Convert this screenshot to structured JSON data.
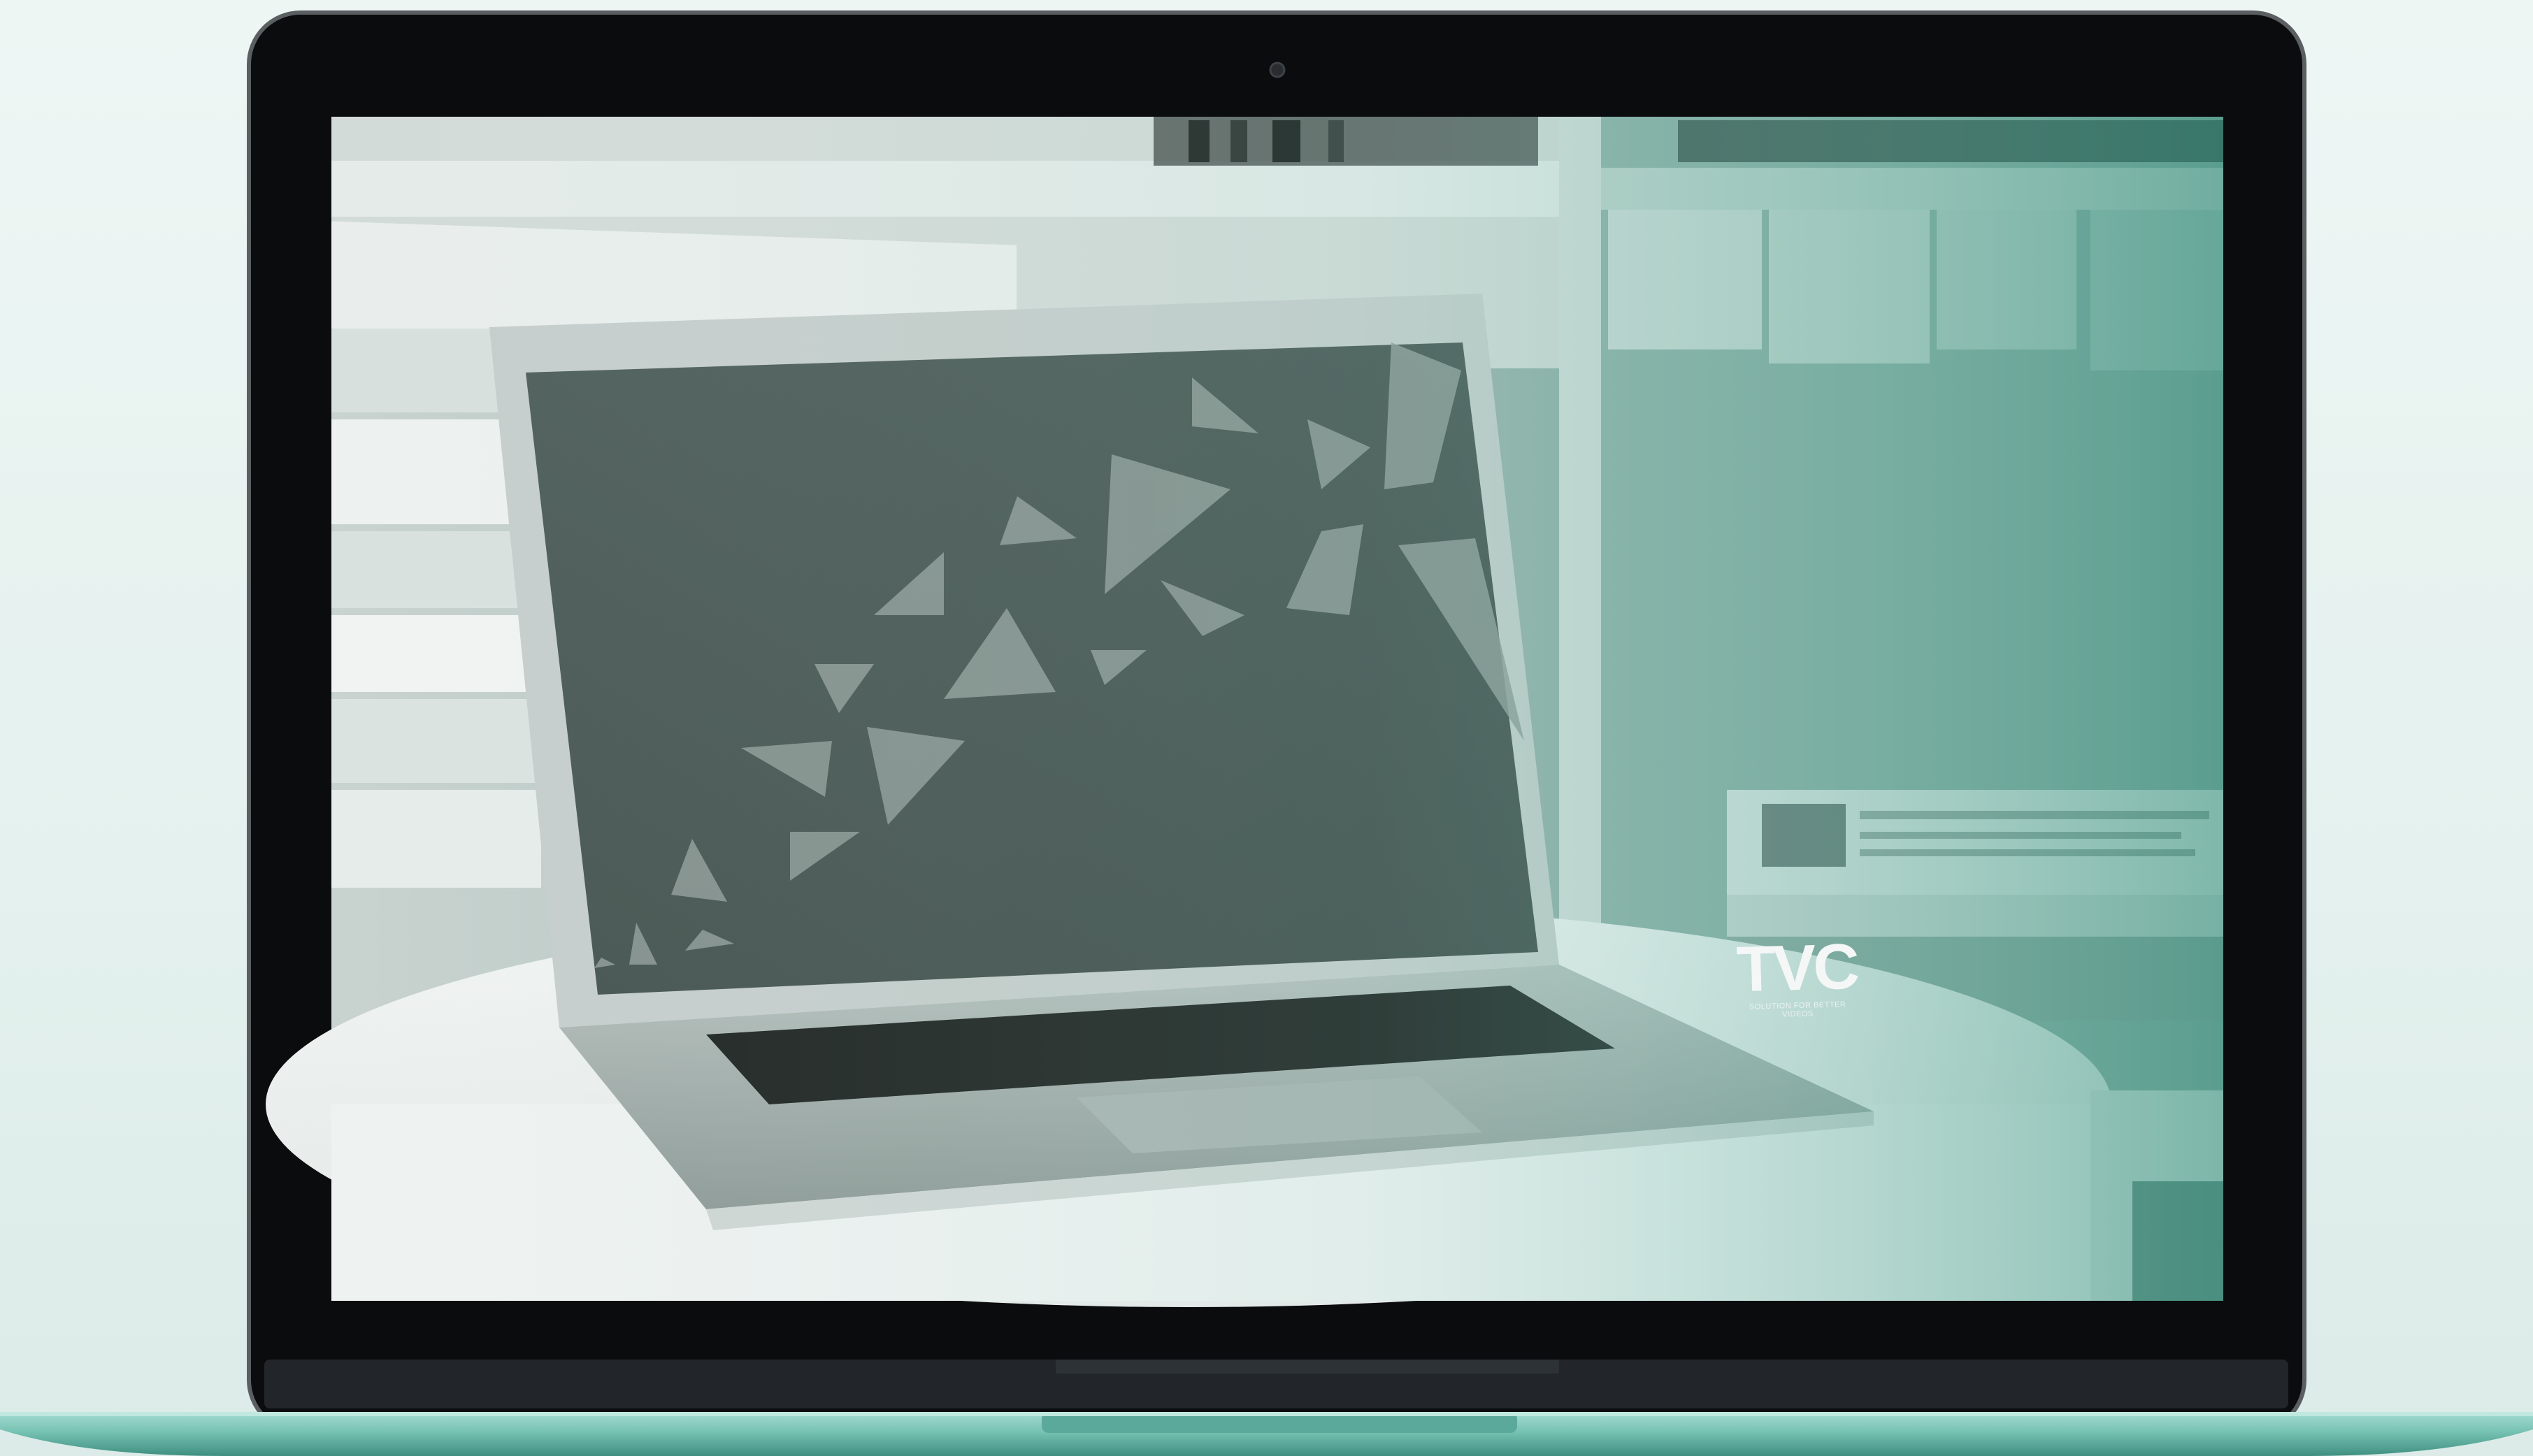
{
  "scene": {
    "subject": "laptop-mockup",
    "screen_photo": "laptop-on-round-white-table-with-shelves",
    "tint_color": "#6fb5a6",
    "frame_color": "#0b0c0d",
    "base_color": "#76c2b3"
  },
  "inner_laptop": {
    "wallpaper_color": "#4a5653",
    "logo": {
      "text": "TVC",
      "tagline": "SOLUTION FOR BETTER VIDEOS"
    }
  }
}
